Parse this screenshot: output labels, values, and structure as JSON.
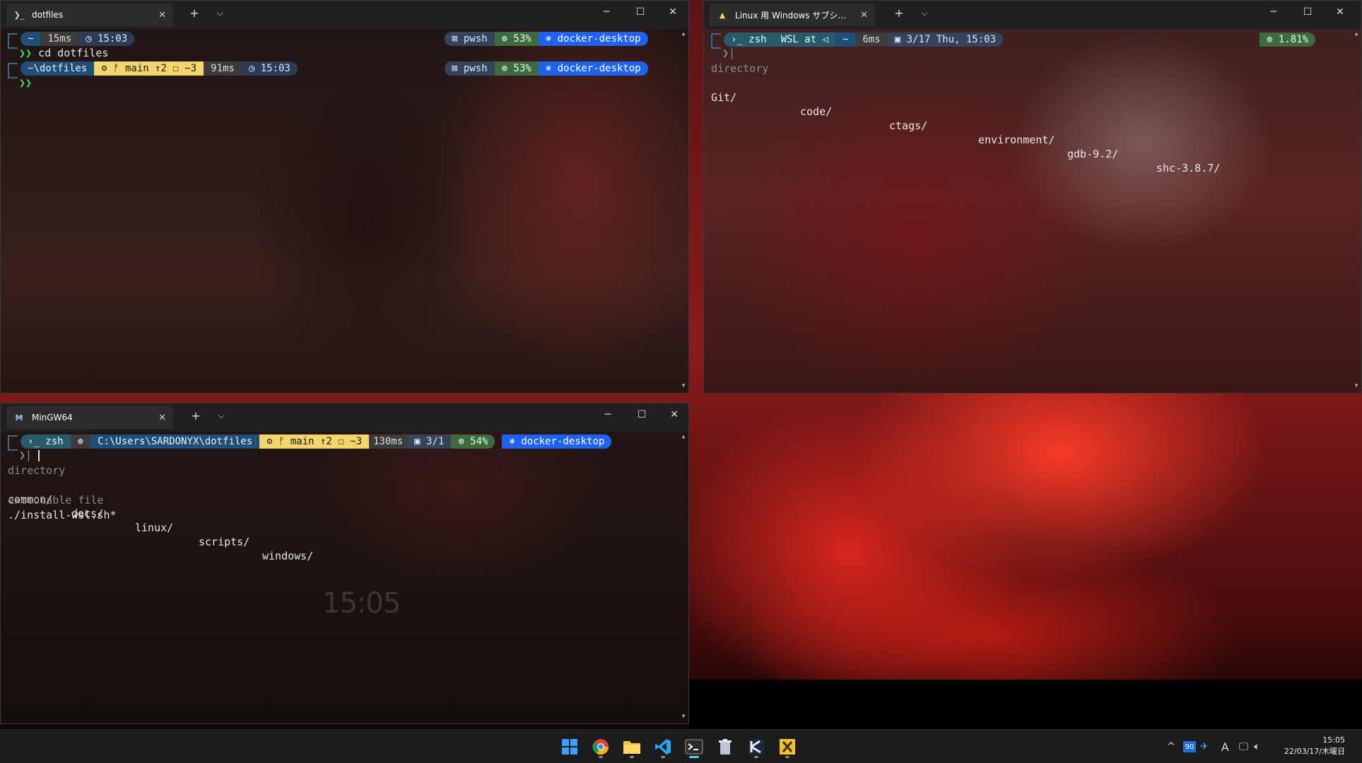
{
  "windows": {
    "top_left": {
      "tab_title": "dotfiles",
      "prompt1": {
        "dir": "~",
        "duration": "15ms",
        "time": "◷ 15:03",
        "shell": "⊠ pwsh",
        "battery": "⊚ 53%",
        "context": "⎈ docker-desktop"
      },
      "cmd_arrow": "❯❯",
      "cmd": "cd dotfiles",
      "prompt2": {
        "dir": "~\\dotfiles",
        "git": "ʘ ᚠ main ↑2 ☐ ~3",
        "duration": "91ms",
        "time": "◷ 15:03",
        "shell": "⊠ pwsh",
        "battery": "⊚ 53%",
        "context": "⎈ docker-desktop"
      },
      "arrow": "❯❯"
    },
    "top_right": {
      "tab_title": "Linux 用 Windows サブシステム：",
      "prompt": {
        "shell": "›_ zsh",
        "wsl": "WSL at ◁",
        "dir": "~",
        "duration": "6ms",
        "date": "▣ 3/17 Thu, 15:03",
        "cpu": "⊚ 1.81%"
      },
      "arrow": "❯|",
      "label": "directory",
      "listing": [
        "Git/",
        "code/",
        "ctags/",
        "environment/",
        "gdb-9.2/",
        "shc-3.8.7/"
      ]
    },
    "bottom_left": {
      "tab_title": "MinGW64",
      "prompt": {
        "shell": "›_ zsh",
        "sep": "⊛",
        "path": "C:\\Users\\SARDONYX\\dotfiles",
        "git": "ʘ ᚠ main ↑2 ☐ ~3",
        "duration": "130ms",
        "date": "▣ 3/1",
        "battery": "⊚ 54%",
        "context": "⎈ docker-desktop"
      },
      "arrow": "❯|",
      "label_dir": "directory",
      "listing": [
        "common/",
        "docs/",
        "linux/",
        "scripts/",
        "windows/"
      ],
      "label_exec": "executable file",
      "exec": "./install-wsl.sh*",
      "overlay_time": "15:05"
    }
  },
  "controls": {
    "new_tab": "+",
    "dropdown": "⌵",
    "close": "✕",
    "minimize": "─",
    "maximize": "☐"
  },
  "taskbar": {
    "apps": [
      "start-icon",
      "chrome-icon",
      "file-explorer-icon",
      "vscode-icon",
      "terminal-icon",
      "recycle-bin-icon",
      "app-k-icon",
      "app-x-icon"
    ],
    "tray": {
      "chevron": "^",
      "badge": "90",
      "ime": "A"
    },
    "clock": {
      "time": "15:05",
      "date": "22/03/17/木曜日"
    }
  }
}
